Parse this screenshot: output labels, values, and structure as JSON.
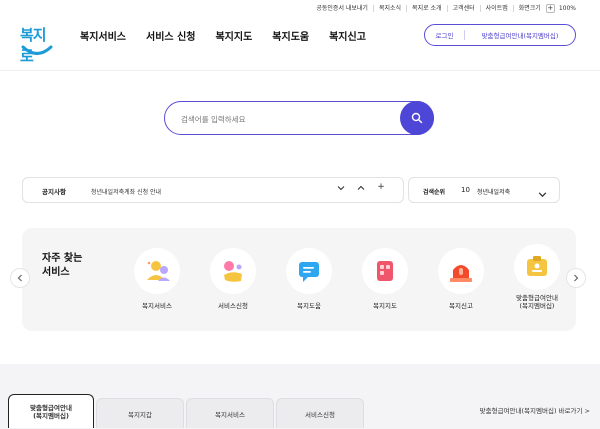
{
  "utility": {
    "items": [
      "공동인증서 내보내기",
      "복지소식",
      "복지로 소개",
      "고객센터",
      "사이트맵",
      "화면크기"
    ],
    "zoom_in": "+",
    "zoom_value": "100%"
  },
  "header": {
    "logo_text": "복지로",
    "nav": [
      "복지서비스",
      "서비스 신청",
      "복지지도",
      "복지도움",
      "복지신고"
    ],
    "login_label": "로그인",
    "guide_label": "맞춤형급여안내(복지멤버십)"
  },
  "search": {
    "placeholder": "검색어를 입력하세요"
  },
  "notice": {
    "label": "공지사항",
    "text": "청년내일저축계좌 신청 안내",
    "controls": [
      "⌄",
      "⌃",
      "+"
    ]
  },
  "ranking": {
    "label": "검색순위",
    "rank": "10",
    "keyword": "청년내일저축"
  },
  "frequent": {
    "title_line1": "자주 찾는",
    "title_line2": "서비스",
    "services": [
      {
        "label": "복지서비스",
        "icon": "people-icon"
      },
      {
        "label": "서비스신청",
        "icon": "hand-icon"
      },
      {
        "label": "복지도움",
        "icon": "chat-icon"
      },
      {
        "label": "복지지도",
        "icon": "map-icon"
      },
      {
        "label": "복지신고",
        "icon": "siren-icon"
      },
      {
        "label": "맞춤형급여안내\n(복지멤버십)",
        "icon": "id-card-icon"
      }
    ]
  },
  "bottom_tabs": {
    "tabs": [
      "맞춤형급여안내\n(복지멤버십)",
      "복지지갑",
      "복지서비스",
      "서비스신청"
    ],
    "link": "맞춤형급여안내(복지멤버십) 바로가기 >"
  },
  "colors": {
    "accent": "#4d46d6",
    "logo": "#1d9bd7",
    "panel": "#f5f5f5"
  }
}
